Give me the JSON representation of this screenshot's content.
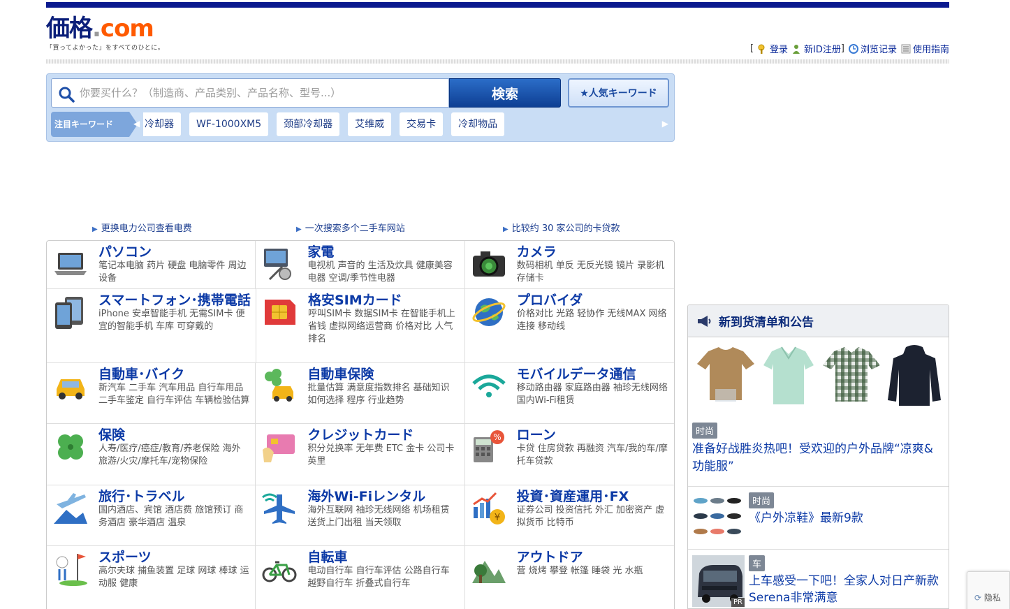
{
  "colors": {
    "brand": "#0b1a8f",
    "accent": "#ff5a00",
    "link": "#0c3aa6"
  },
  "logo": {
    "kakaku": "価格",
    "dot": ".",
    "com": "com",
    "tagline": "「買ってよかった」をすべてのひとに。"
  },
  "userlinks": {
    "bracket_open": "[",
    "login": "登录",
    "register": "新ID注册",
    "bracket_close": "]",
    "history": "浏览记录",
    "guide": "使用指南"
  },
  "search": {
    "placeholder": "你要买什么？（制造商、产品类别、产品名称、型号...）",
    "button": "検索",
    "popular": "人気キーワード"
  },
  "keywords": {
    "label": "注目キーワード",
    "items": [
      "冷却器",
      "WF-1000XM5",
      "颈部冷却器",
      "艾维威",
      "交易卡",
      "冷却物品"
    ]
  },
  "promo_links": [
    "更换电力公司查看电费",
    "一次搜索多个二手车网站",
    "比较约 30 家公司的卡贷款"
  ],
  "categories": [
    [
      {
        "icon": "laptop-icon",
        "title": "パソコン",
        "sub": "笔记本电脑 药片 硬盘 电脑零件 周边设备"
      },
      {
        "icon": "appliance-icon",
        "title": "家電",
        "sub": "电视机 声音的 生活及炊具 健康美容电器 空调/季节性电器"
      },
      {
        "icon": "camera-icon",
        "title": "カメラ",
        "sub": "数码相机 单反 无反光镜 镜片 录影机 存储卡"
      }
    ],
    [
      {
        "icon": "smartphone-icon",
        "title": "スマートフォン･携帯電話",
        "sub": "iPhone 安卓智能手机 无需SIM卡 便宜的智能手机 车库 可穿戴的"
      },
      {
        "icon": "sim-card-icon",
        "title": "格安SIMカード",
        "sub": "呼叫SIM卡 数据SIM卡 在智能手机上省钱 虚拟网络运营商 价格对比 人气排名"
      },
      {
        "icon": "globe-icon",
        "title": "プロバイダ",
        "sub": "价格对比 光路 轻协作 无线MAX 网络连接 移动线"
      }
    ],
    [
      {
        "icon": "car-icon",
        "title": "自動車･バイク",
        "sub": "新汽车 二手车 汽车用品 自行车用品 二手车鉴定 自行车评估 车辆检验估算"
      },
      {
        "icon": "car-insurance-icon",
        "title": "自動車保険",
        "sub": "批量估算 满意度指数排名 基础知识 如何选择 程序 行业趋势"
      },
      {
        "icon": "wifi-icon",
        "title": "モバイルデータ通信",
        "sub": "移动路由器 家庭路由器 袖珍无线网络 国内Wi-Fi租赁"
      }
    ],
    [
      {
        "icon": "clover-icon",
        "title": "保険",
        "sub": "人寿/医疗/癌症/教育/养老保险 海外旅游/火灾/摩托车/宠物保险"
      },
      {
        "icon": "credit-card-icon",
        "title": "クレジットカード",
        "sub": "积分兑换率 无年费 ETC 金卡 公司卡 英里"
      },
      {
        "icon": "loan-calculator-icon",
        "title": "ローン",
        "sub": "卡贷 住房贷款 再融资 汽车/我的车/摩托车贷款"
      }
    ],
    [
      {
        "icon": "airplane-icon",
        "title": "旅行･トラベル",
        "sub": "国内酒店、宾馆 酒店费 旅馆预订 商务酒店 豪华酒店 温泉"
      },
      {
        "icon": "wifi-airplane-icon",
        "title": "海外Wi-Fiレンタル",
        "sub": "海外互联网 袖珍无线网络 机场租赁 送货上门出租 当天领取"
      },
      {
        "icon": "investment-chart-icon",
        "title": "投資･資産運用･FX",
        "sub": "证券公司 投资信托 外汇 加密资产 虚拟货币 比特币"
      }
    ],
    [
      {
        "icon": "golf-icon",
        "title": "スポーツ",
        "sub": "高尔夫球 捕鱼装置 足球 网球 棒球 运动服 健康"
      },
      {
        "icon": "bicycle-icon",
        "title": "自転車",
        "sub": "电动自行车 自行车评估 公路自行车 越野自行车 折叠式自行车"
      },
      {
        "icon": "mountain-tree-icon",
        "title": "アウトドア",
        "sub": "营 烧烤 攀登 帐篷 睡袋 光 水瓶"
      }
    ]
  ],
  "news": {
    "heading": "新到货清单和公告",
    "featured": {
      "tag": "时尚",
      "title": "准备好战胜炎热吧！受欢迎的户外品牌“凉爽&功能服”"
    },
    "items": [
      {
        "tag": "时尚",
        "title": "《户外凉鞋》最新9款"
      },
      {
        "tag": "车",
        "title": "上车感受一下吧！全家人对日产新款Serena非常满意",
        "pr": "PR"
      }
    ]
  },
  "recaptcha": {
    "label": "隐私"
  }
}
